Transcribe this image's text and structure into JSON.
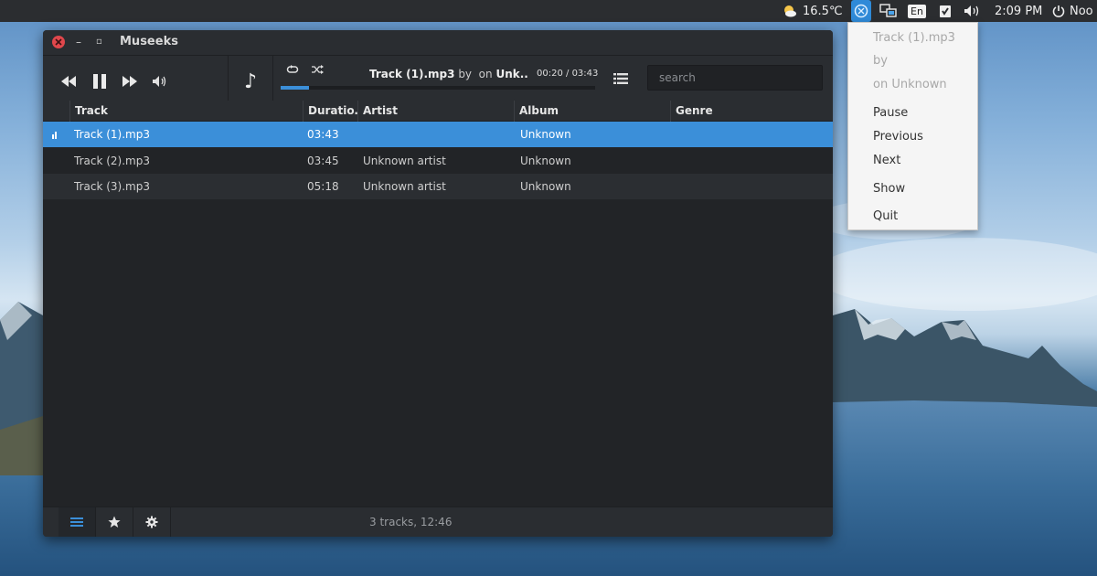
{
  "panel": {
    "weather": "16.5℃",
    "language": "En",
    "clock": "2:09 PM",
    "user": "Noo"
  },
  "window": {
    "title": "Museeks"
  },
  "player": {
    "track": "Track (1).mp3",
    "by": "by",
    "on": "on",
    "album_short": "Unk..",
    "elapsed": "00:20",
    "duration": "03:43",
    "progress": 0.09
  },
  "search": {
    "placeholder": "search",
    "value": ""
  },
  "table": {
    "columns": [
      "Track",
      "Duratio…",
      "Artist",
      "Album",
      "Genre"
    ],
    "rows": [
      {
        "track": "Track (1).mp3",
        "duration": "03:43",
        "artist": "",
        "album": "Unknown",
        "genre": "",
        "playing": true
      },
      {
        "track": "Track (2).mp3",
        "duration": "03:45",
        "artist": "Unknown artist",
        "album": "Unknown",
        "genre": "",
        "playing": false
      },
      {
        "track": "Track (3).mp3",
        "duration": "05:18",
        "artist": "Unknown artist",
        "album": "Unknown",
        "genre": "",
        "playing": false
      }
    ]
  },
  "footer": {
    "status": "3 tracks, 12:46"
  },
  "tray_menu": {
    "track": "Track (1).mp3",
    "by": "by",
    "on_album": "on Unknown",
    "pause": "Pause",
    "previous": "Previous",
    "next": "Next",
    "show": "Show",
    "quit": "Quit"
  },
  "colors": {
    "accent": "#3b8fd9",
    "close": "#e0474c",
    "window_bg": "#2a2d31",
    "list_bg": "#222427"
  },
  "icons": [
    "weather-icon",
    "museeks-tray-icon",
    "network-icon",
    "clipboard-icon",
    "volume-icon",
    "power-icon",
    "rewind-icon",
    "pause-icon",
    "forward-icon",
    "volume-icon",
    "music-note-icon",
    "repeat-icon",
    "shuffle-icon",
    "queue-list-icon",
    "playing-bars-icon",
    "library-icon",
    "star-icon",
    "gear-icon"
  ]
}
